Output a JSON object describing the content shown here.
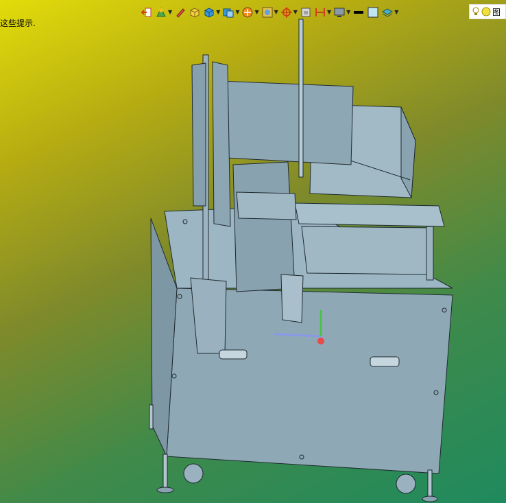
{
  "hint": {
    "text": "这些提示."
  },
  "toolbar": {
    "tools": [
      {
        "id": "previous-view",
        "icon": "previous-view-icon",
        "dropdown": false
      },
      {
        "id": "section-view",
        "icon": "section-view-icon",
        "dropdown": true
      },
      {
        "id": "dynamic-annotation",
        "icon": "pencil-icon",
        "dropdown": false
      },
      {
        "id": "zoom-fit",
        "icon": "cube-yellow-icon",
        "dropdown": false
      },
      {
        "id": "view-orientation",
        "icon": "cube-blue-icon",
        "dropdown": true
      },
      {
        "id": "display-style",
        "icon": "display-style-icon",
        "dropdown": true
      },
      {
        "id": "hide-show",
        "icon": "hide-show-icon",
        "dropdown": true
      },
      {
        "id": "edit-appearance",
        "icon": "appearance-icon",
        "dropdown": true
      },
      {
        "id": "apply-scene",
        "icon": "scene-icon",
        "dropdown": true
      },
      {
        "id": "view-settings",
        "icon": "view-settings-icon",
        "dropdown": false
      },
      {
        "id": "section-settings",
        "icon": "section-settings-icon",
        "dropdown": true
      },
      {
        "id": "monitor",
        "icon": "monitor-icon",
        "dropdown": true
      },
      {
        "id": "line-style",
        "icon": "line-icon",
        "dropdown": false
      },
      {
        "id": "color-box",
        "icon": "color-box-icon",
        "dropdown": false
      },
      {
        "id": "layers",
        "icon": "layers-icon",
        "dropdown": true
      }
    ]
  },
  "right_panel": {
    "label": "图"
  },
  "colors": {
    "model_fill": "#93aebb",
    "model_stroke": "#1e2a30",
    "axis_x": "#8a98e6",
    "axis_y": "#49c24a",
    "axis_z": "#e84a4a"
  }
}
